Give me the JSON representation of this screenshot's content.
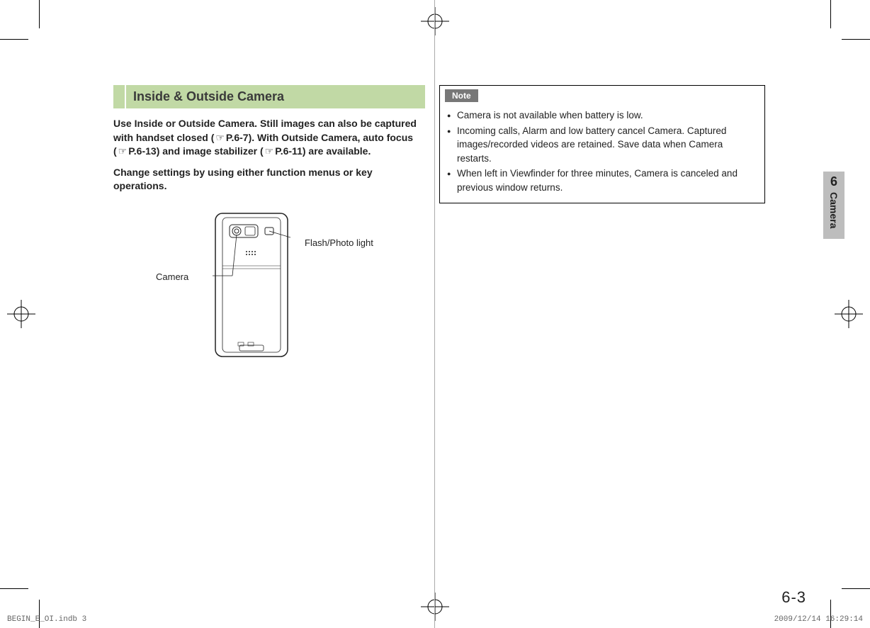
{
  "heading": "Inside & Outside Camera",
  "intro_line1": "Use Inside or Outside Camera. Still images can also be captured with handset closed (",
  "intro_ref1": "P.6-7",
  "intro_line2": "). With Outside Camera, auto focus (",
  "intro_ref2": "P.6-13",
  "intro_line3": ") and image stabilizer (",
  "intro_ref3": "P.6-11",
  "intro_line4": ") are available.",
  "intro2": "Change settings by using either function menus or key operations.",
  "diagram": {
    "camera_label": "Camera",
    "flash_label": "Flash/Photo light"
  },
  "note": {
    "label": "Note",
    "items": [
      "Camera is not available when battery is low.",
      "Incoming calls, Alarm and low battery cancel Camera. Captured images/recorded videos are retained. Save data when Camera restarts.",
      "When left in Viewfinder for three minutes, Camera is canceled and previous window returns."
    ]
  },
  "sidetab": {
    "num": "6",
    "label": "Camera"
  },
  "page_number": "6-3",
  "footer": {
    "left": "BEGIN_E_OI.indb   3",
    "right": "2009/12/14   16:29:14"
  }
}
